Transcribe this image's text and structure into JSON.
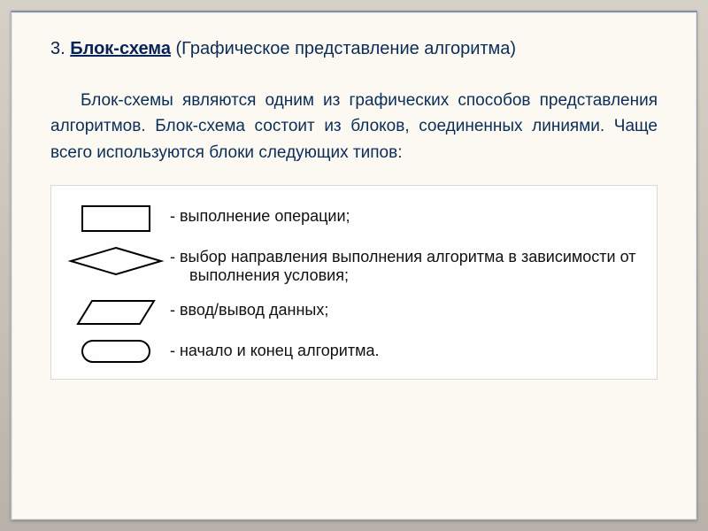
{
  "heading": {
    "number": "3.",
    "term": "Блок-схема",
    "rest": "(Графическое представление алгоритма)"
  },
  "paragraph": "Блок-схемы являются одним из графических способов представления алгоритмов. Блок-схема состоит из блоков, соединенных линиями. Чаще всего используются блоки следующих типов:",
  "shapes": [
    {
      "label": "- выполнение операции;",
      "cont": ""
    },
    {
      "label": "- выбор направления выполнения алгоритма в зависимости от",
      "cont": "выполнения условия;"
    },
    {
      "label": "- ввод/вывод данных;",
      "cont": ""
    },
    {
      "label": "- начало и конец алгоритма.",
      "cont": ""
    }
  ]
}
